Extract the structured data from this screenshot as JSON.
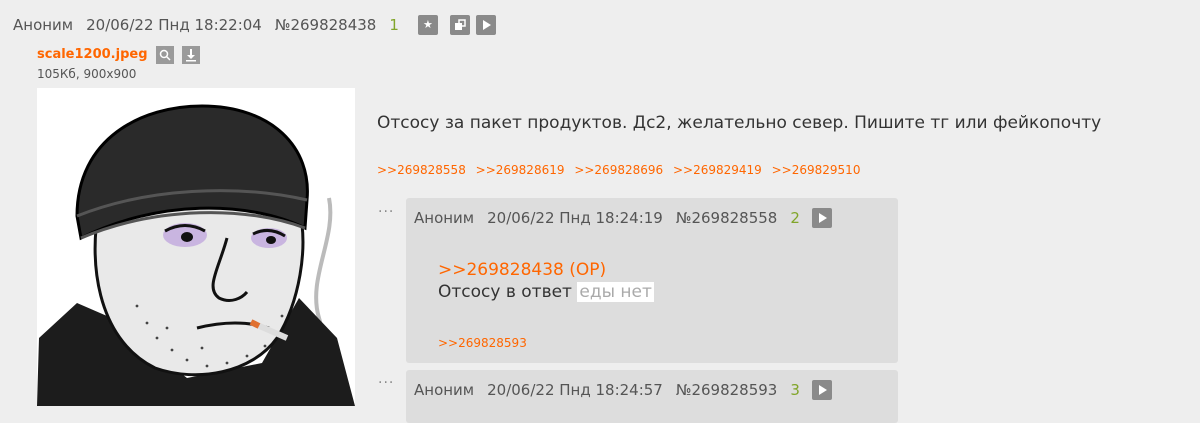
{
  "op": {
    "author": "Аноним",
    "date": "20/06/22 Пнд 18:22:04",
    "num": "№269828438",
    "index": "1",
    "file": {
      "name": "scale1200.jpeg",
      "meta": "105Кб, 900x900"
    },
    "text": "Отсосу за пакет продуктов. Дс2, желательно север. Пишите тг или фейкопочту",
    "replies": [
      ">>269828558",
      ">>269828619",
      ">>269828696",
      ">>269829419",
      ">>269829510"
    ]
  },
  "posts": [
    {
      "author": "Аноним",
      "date": "20/06/22 Пнд 18:24:19",
      "num": "№269828558",
      "index": "2",
      "quote": ">>269828438 (OP)",
      "text": "Отсосу в ответ",
      "spoiler": "еды нет",
      "replies": [
        ">>269828593"
      ]
    },
    {
      "author": "Аноним",
      "date": "20/06/22 Пнд 18:24:57",
      "num": "№269828593",
      "index": "3"
    }
  ],
  "dots": "···"
}
